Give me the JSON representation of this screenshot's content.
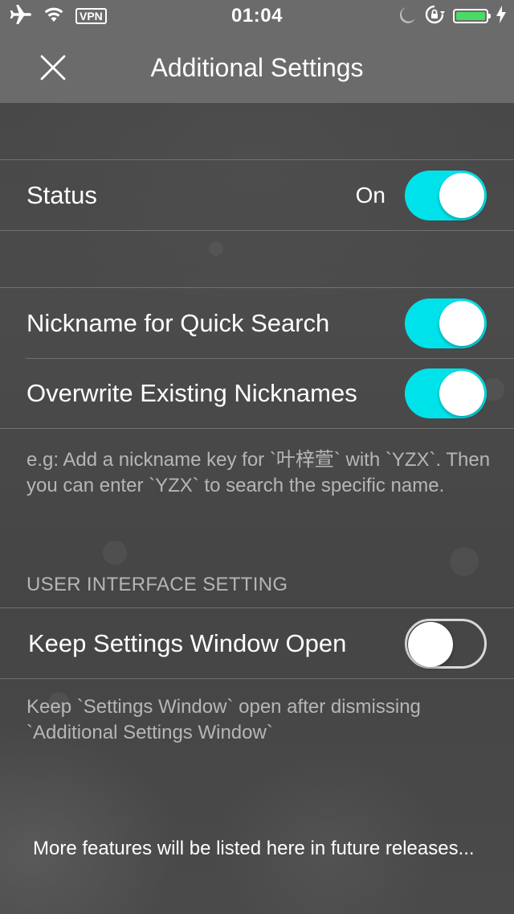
{
  "status_bar": {
    "time": "01:04",
    "vpn_label": "VPN",
    "icons": [
      "airplane-icon",
      "wifi-icon",
      "moon-icon",
      "rotation-lock-icon",
      "battery-icon",
      "charging-icon"
    ],
    "battery_color": "#4cd964"
  },
  "nav": {
    "title": "Additional Settings",
    "close_icon": "close-icon"
  },
  "status_group": {
    "label": "Status",
    "value": "On",
    "toggle_on": true
  },
  "nickname_group": {
    "rows": [
      {
        "label": "Nickname for Quick Search",
        "toggle_on": true
      },
      {
        "label": "Overwrite Existing Nicknames",
        "toggle_on": true
      }
    ],
    "footnote": "e.g: Add a nickname key for `叶梓萱` with `YZX`. Then you can enter `YZX` to search the specific name."
  },
  "ui_section": {
    "header": "USER INTERFACE SETTING",
    "rows": [
      {
        "label": "Keep Settings Window Open",
        "toggle_on": false
      }
    ],
    "footnote": "Keep `Settings Window` open after dismissing `Additional Settings Window`"
  },
  "more": {
    "text": "More features will be listed here in future releases..."
  },
  "colors": {
    "accent": "#00e2ea",
    "navbar": "#6b6b6b",
    "background": "#4a4a4a"
  }
}
